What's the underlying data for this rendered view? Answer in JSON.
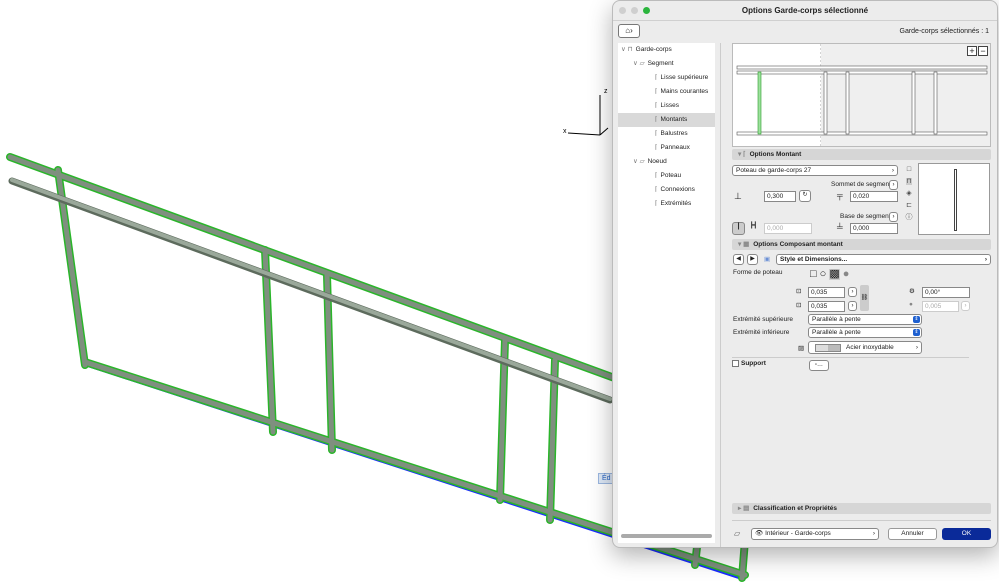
{
  "viewport": {
    "axis_z": "z",
    "axis_x": "x",
    "edit_tag": "Éd"
  },
  "dialog": {
    "title": "Options Garde-corps sélectionné",
    "selected_count": "Garde-corps sélectionnés : 1",
    "tree": [
      {
        "label": "Garde-corps",
        "level": 0,
        "expand": "∨"
      },
      {
        "label": "Segment",
        "level": 1,
        "expand": "∨"
      },
      {
        "label": "Lisse supérieure",
        "level": 2
      },
      {
        "label": "Mains courantes",
        "level": 2
      },
      {
        "label": "Lisses",
        "level": 2
      },
      {
        "label": "Montants",
        "level": 2,
        "selected": true
      },
      {
        "label": "Balustres",
        "level": 2
      },
      {
        "label": "Panneaux",
        "level": 2
      },
      {
        "label": "Noeud",
        "level": 1,
        "expand": "∨"
      },
      {
        "label": "Poteau",
        "level": 2
      },
      {
        "label": "Connexions",
        "level": 2
      },
      {
        "label": "Extrémités",
        "level": 2
      }
    ],
    "zoom_in": "+",
    "zoom_out": "−",
    "options_montant": {
      "header": "Options Montant",
      "profile": "Poteau de garde-corps 27",
      "offset": "0,300",
      "sommet_label": "Sommet de segment",
      "sommet_value": "0,020",
      "base_label": "Base de segment",
      "base_value": "0,000",
      "spacing_value": "0,000"
    },
    "composant": {
      "header": "Options Composant montant",
      "page_select": "Style et Dimensions...",
      "forme_label": "Forme de poteau",
      "width": "0,035",
      "depth": "0,035",
      "angle": "0,00°",
      "radius": "0,005",
      "ext_sup_label": "Extrémité supérieure",
      "ext_sup_value": "Parallèle à pente",
      "ext_inf_label": "Extrémité inférieure",
      "ext_inf_value": "Parallèle à pente",
      "material": "Acier inoxydable",
      "support_label": "Support",
      "support_checked": false
    },
    "classification": "Classification et Propriétés",
    "layer": "Intérieur - Garde-corps",
    "cancel": "Annuler",
    "ok": "OK"
  }
}
